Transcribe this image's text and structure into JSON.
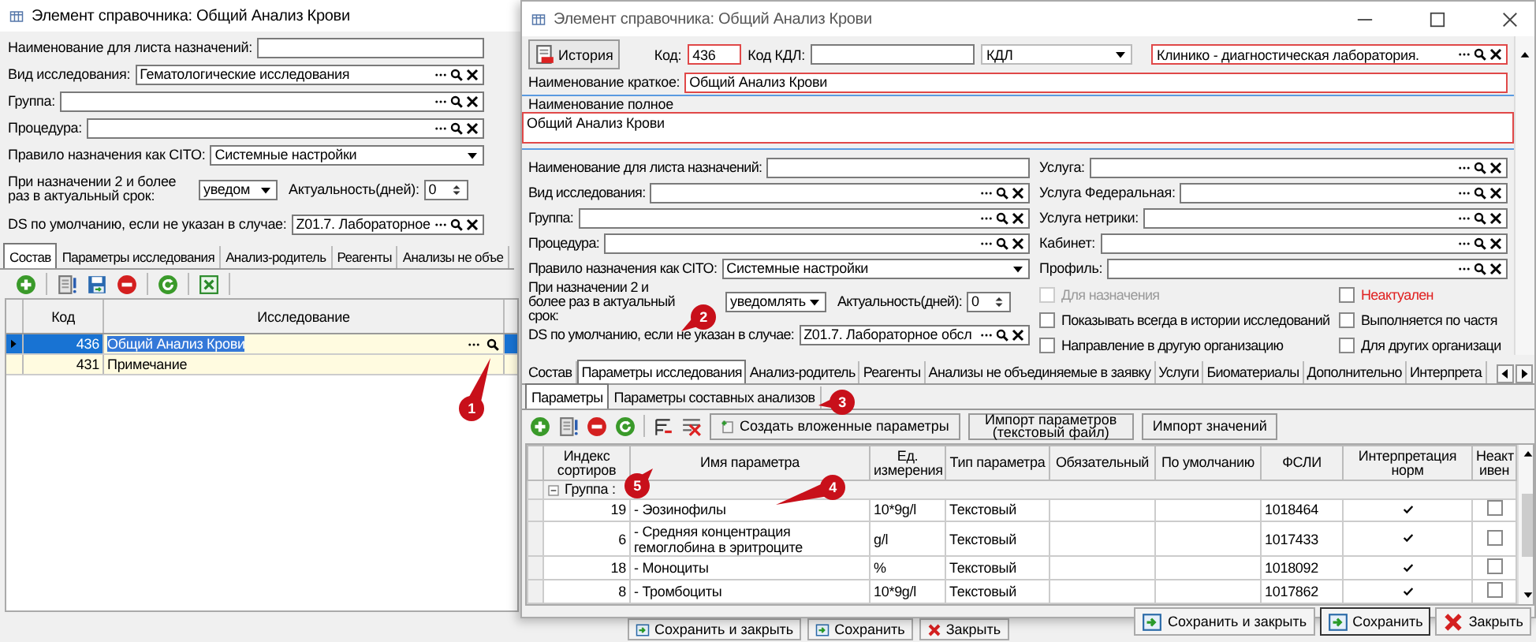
{
  "left_window": {
    "title": "Элемент справочника: Общий Анализ Крови",
    "fields": [
      {
        "kind": "text",
        "label": "Наименование для листа назначений:"
      },
      {
        "kind": "lookup",
        "label": "Вид исследования:",
        "value": "Гематологические исследования"
      },
      {
        "kind": "lookup",
        "label": "Группа:"
      },
      {
        "kind": "lookup",
        "label": "Процедура:"
      },
      {
        "kind": "select",
        "label": "Правило назначения как CITO:",
        "value": "Системные настройки"
      },
      {
        "kind": "pair",
        "label": "При назначении 2 и более раз в актуальный срок:",
        "value": "уведом",
        "spin_label": "Актуальность(дней):",
        "spin_value": "0"
      },
      {
        "kind": "lookup",
        "label": "DS по умолчанию, если не указан в случае:",
        "value": "Z01.7. Лабораторное"
      }
    ],
    "tabs": [
      {
        "label": "Состав",
        "selected": true
      },
      {
        "label": "Параметры исследования",
        "selected": false
      },
      {
        "label": "Анализ-родитель",
        "selected": false
      },
      {
        "label": "Реагенты",
        "selected": false
      },
      {
        "label": "Анализы не объе",
        "selected": false
      }
    ],
    "grid": {
      "columns": [
        "Код",
        "Исследование"
      ],
      "rows": [
        {
          "code": "436",
          "name": "Общий Анализ Крови",
          "selected": true
        },
        {
          "code": "431",
          "name": "Примечание",
          "selected": false
        }
      ]
    },
    "buttons": [
      {
        "kind": "save_close",
        "label": "Сохранить и закрыть"
      },
      {
        "kind": "save",
        "label": "Сохранить"
      },
      {
        "kind": "close",
        "label": "Закрыть"
      }
    ]
  },
  "right_window": {
    "title": "Элемент справочника: Общий Анализ Крови",
    "history_button": "История",
    "code": {
      "label": "Код:",
      "value": "436",
      "required": true
    },
    "kdl_code": {
      "label": "Код КДЛ:",
      "required": false
    },
    "kdl_select": "КДЛ",
    "lab": {
      "value": "Клинико - диагностическая лаборатория.",
      "required": true
    },
    "short_name": {
      "label": "Наименование краткое:",
      "value": "Общий Анализ Крови",
      "required": true
    },
    "full_name": {
      "label": "Наименование полное",
      "value": "Общий Анализ Крови",
      "required": true
    },
    "fields_left": [
      {
        "kind": "text",
        "label": "Наименование для листа назначений:"
      },
      {
        "kind": "lookup",
        "label": "Вид исследования:"
      },
      {
        "kind": "lookup",
        "label": "Группа:"
      },
      {
        "kind": "lookup",
        "label": "Процедура:"
      },
      {
        "kind": "select",
        "label": "Правило назначения как CITO:",
        "value": "Системные настройки"
      },
      {
        "kind": "pair",
        "label": "При назначении 2 и более раз в актуальный срок:",
        "value": "уведомлять",
        "spin_label": "Актуальность(дней):",
        "spin_value": "0"
      },
      {
        "kind": "lookup",
        "label": "DS по умолчанию, если не указан в случае:",
        "value": "Z01.7. Лабораторное обсл"
      }
    ],
    "fields_right": [
      {
        "kind": "lookup",
        "label": "Услуга:"
      },
      {
        "kind": "lookup",
        "label": "Услуга Федеральная:"
      },
      {
        "kind": "lookup",
        "label": "Услуга нетрики:"
      },
      {
        "kind": "lookup",
        "label": "Кабинет:"
      },
      {
        "kind": "lookup",
        "label": "Профиль:"
      }
    ],
    "checkboxes": [
      {
        "label": "Для назначения",
        "checked": false,
        "disabled": true,
        "warning": false
      },
      {
        "label": "Неактуален",
        "checked": false,
        "disabled": false,
        "warning": true
      },
      {
        "label": "Показывать всегда в истории исследований",
        "checked": false,
        "disabled": false,
        "warning": false
      },
      {
        "label": "Выполняется по частя",
        "checked": false,
        "disabled": false,
        "warning": false
      },
      {
        "label": "Направление в другую организацию",
        "checked": false,
        "disabled": false,
        "warning": false
      },
      {
        "label": "Для других организаци",
        "checked": false,
        "disabled": false,
        "warning": false
      }
    ],
    "tabs": [
      {
        "label": "Состав",
        "selected": false
      },
      {
        "label": "Параметры исследования",
        "selected": true
      },
      {
        "label": "Анализ-родитель",
        "selected": false
      },
      {
        "label": "Реагенты",
        "selected": false
      },
      {
        "label": "Анализы не объединяемые в заявку",
        "selected": false
      },
      {
        "label": "Услуги",
        "selected": false
      },
      {
        "label": "Биоматериалы",
        "selected": false
      },
      {
        "label": "Дополнительно",
        "selected": false
      },
      {
        "label": "Интерпрета",
        "selected": false
      }
    ],
    "subtabs": [
      {
        "label": "Параметры",
        "selected": true
      },
      {
        "label": "Параметры составных анализов",
        "selected": false
      }
    ],
    "toolbar_buttons": [
      {
        "kind": "create",
        "label": "Создать вложенные параметры"
      },
      {
        "kind": "plain",
        "label": "Импорт параметров (текстовый файл)"
      },
      {
        "kind": "plain",
        "label": "Импорт значений"
      }
    ],
    "table": {
      "columns": [
        "Индекс сортиров",
        "Имя параметра",
        "Ед. измерения",
        "Тип параметра",
        "Обязательный",
        "По умолчанию",
        "ФСЛИ",
        "Интерпретация норм",
        "Неакт ивен"
      ],
      "group": "Группа :",
      "rows": [
        {
          "index": "19",
          "name": " - Эозинофилы",
          "unit": "10*9g/l",
          "type": "Текстовый",
          "fsli": "1018464",
          "interpretation": true,
          "inactive": false
        },
        {
          "index": "6",
          "name": " - Средняя концентрация гемоглобина в эритроците",
          "unit": "g/l",
          "type": "Текстовый",
          "fsli": "1017433",
          "interpretation": true,
          "inactive": false
        },
        {
          "index": "18",
          "name": " - Моноциты",
          "unit": "%",
          "type": "Текстовый",
          "fsli": "1018092",
          "interpretation": true,
          "inactive": false
        },
        {
          "index": "8",
          "name": " - Тромбоциты",
          "unit": "10*9g/l",
          "type": "Текстовый",
          "fsli": "1017862",
          "interpretation": true,
          "inactive": false
        }
      ]
    },
    "buttons": [
      {
        "kind": "save_close",
        "label": "Сохранить и закрыть"
      },
      {
        "kind": "save",
        "label": "Сохранить"
      },
      {
        "kind": "close",
        "label": "Закрыть"
      }
    ]
  },
  "callouts": [
    {
      "number": "1"
    },
    {
      "number": "2"
    },
    {
      "number": "3"
    },
    {
      "number": "4"
    },
    {
      "number": "5"
    }
  ]
}
